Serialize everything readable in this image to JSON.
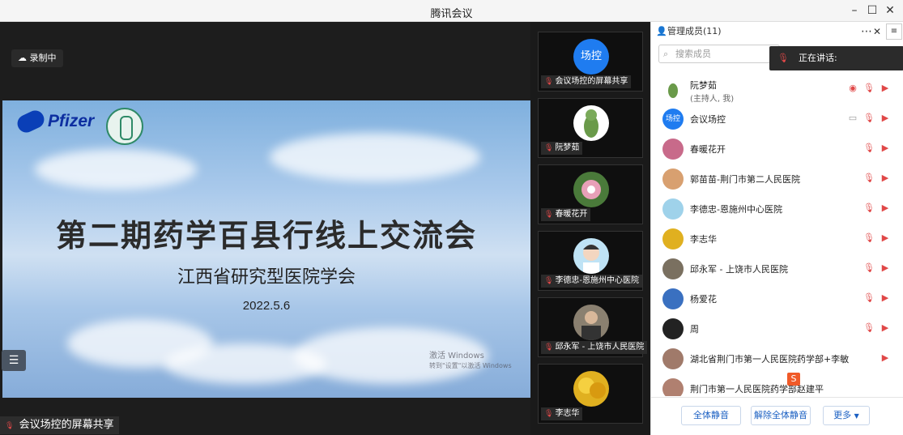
{
  "window": {
    "title": "腾讯会议"
  },
  "main": {
    "recording_label": "录制中",
    "slide": {
      "logo_text": "Pfizer",
      "title": "第二期药学百县行线上交流会",
      "subtitle": "江西省研究型医院学会",
      "date": "2022.5.6",
      "activate_line1": "激活 Windows",
      "activate_line2": "转到\"设置\"以激活 Windows"
    },
    "share_label": "会议场控的屏幕共享"
  },
  "strip": {
    "tiles": [
      {
        "name": "会议场控的屏幕共享",
        "avatar_text": "场控",
        "avatar_color": "#1f7cf0"
      },
      {
        "name": "阮梦茹"
      },
      {
        "name": "春暖花开"
      },
      {
        "name": "李德忠-恩施州中心医院"
      },
      {
        "name": "邱永军 - 上饶市人民医院"
      },
      {
        "name": "李志华"
      }
    ]
  },
  "panel": {
    "title": "管理成员(11)",
    "search_placeholder": "搜索成员",
    "speaking_label": "正在讲话:",
    "members": [
      {
        "name": "阮梦茹",
        "sub": "(主持人, 我)"
      },
      {
        "name": "会议场控",
        "avatar_text": "场控"
      },
      {
        "name": "春暖花开"
      },
      {
        "name": "郭苗苗-荆门市第二人民医院"
      },
      {
        "name": "李德忠-恩施州中心医院"
      },
      {
        "name": "李志华"
      },
      {
        "name": "邱永军 - 上饶市人民医院"
      },
      {
        "name": "杨爱花"
      },
      {
        "name": "周"
      },
      {
        "name": "湖北省荆门市第一人民医院药学部+李敏"
      },
      {
        "name": "荆门市第一人民医院药学部赵建平"
      }
    ],
    "buttons": {
      "mute_all": "全体静音",
      "unmute_all": "解除全体静音",
      "more": "更多"
    }
  },
  "colors": {
    "accent": "#1a5fc2",
    "muted_red": "#e04848",
    "brand_blue": "#1f7cf0"
  }
}
